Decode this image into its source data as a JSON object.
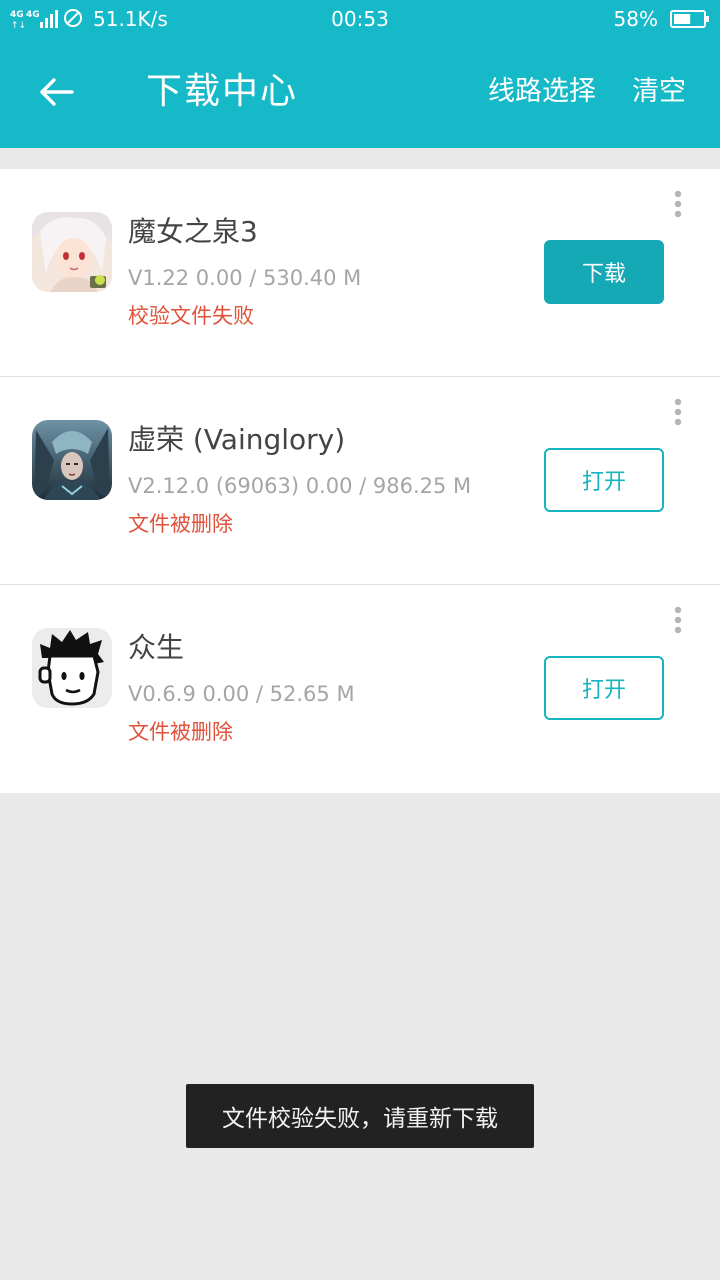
{
  "status_bar": {
    "network": "4G 4G",
    "speed": "51.1K/s",
    "time": "00:53",
    "battery": "58%",
    "battery_level": 0.58
  },
  "header": {
    "title": "下载中心",
    "route_label": "线路选择",
    "clear_label": "清空",
    "bg_color": "#16b9c7"
  },
  "downloads": [
    {
      "name": "魔女之泉3",
      "meta": "V1.22  0.00 / 530.40 M",
      "status": "校验文件失败",
      "action": "下载",
      "action_style": "filled"
    },
    {
      "name": "虚荣 (Vainglory)",
      "meta": "V2.12.0 (69063)  0.00 / 986.25 M",
      "status": "文件被删除",
      "action": "打开",
      "action_style": "outline"
    },
    {
      "name": "众生",
      "meta": "V0.6.9  0.00 / 52.65 M",
      "status": "文件被删除",
      "action": "打开",
      "action_style": "outline"
    }
  ],
  "toast": "文件校验失败，请重新下载",
  "colors": {
    "accent": "#16b9c7",
    "error": "#e0523a"
  }
}
